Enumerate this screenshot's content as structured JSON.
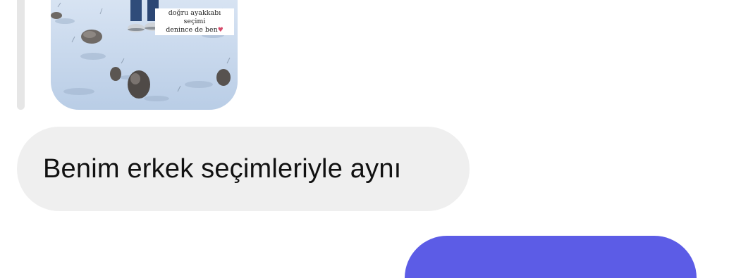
{
  "thread": {
    "shared_media": {
      "caption_line1": "doğru ayakkabı seçimi",
      "caption_line2": "denince de ben",
      "caption_icon": "heart-icon"
    },
    "incoming_message": {
      "text": "Benim erkek seçimleriyle aynı"
    }
  },
  "colors": {
    "incoming_bubble": "#efefef",
    "outgoing_bubble": "#5c5ce6",
    "reply_bar": "#e6e6e6"
  }
}
